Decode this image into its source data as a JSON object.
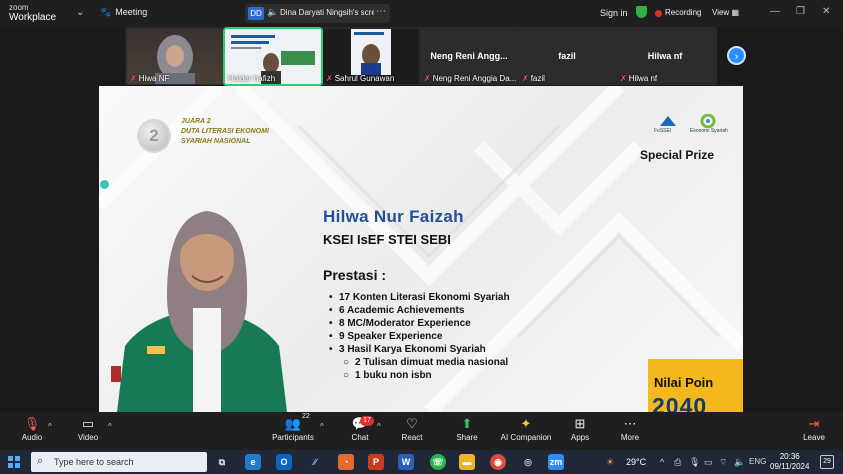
{
  "app": {
    "logo_line1": "zoom",
    "logo_line2": "Workplace",
    "meeting_label": "Meeting"
  },
  "share": {
    "badge": "DD",
    "text": "Dina Daryati Ningsih's screen",
    "more": "⋯"
  },
  "top_right": {
    "signin": "Sign in",
    "recording": "Recording",
    "view": "View"
  },
  "participants": [
    {
      "display_name": "Hiwa NF",
      "big_name": ""
    },
    {
      "display_name": "Haidar hafizh",
      "big_name": ""
    },
    {
      "display_name": "Sahrul Gunawan",
      "big_name": ""
    },
    {
      "display_name": "Neng Reni Anggia Da...",
      "big_name": "Neng Reni Angg..."
    },
    {
      "display_name": "fazil",
      "big_name": "fazil"
    },
    {
      "display_name": "Hilwa nf",
      "big_name": "Hilwa nf"
    }
  ],
  "slide": {
    "medal_number": "2",
    "award_line1": "JUARA 2",
    "award_line2": "DUTA LITERASI EKONOMI",
    "award_line3": "SYARIAH NASIONAL",
    "logo1_caption": "FoSSEI",
    "logo2_caption": "Ekonomi Syariah",
    "special": "Special Prize",
    "name": "Hilwa Nur Faizah",
    "org": "KSEI IsEF STEI SEBI",
    "prestasi_title": "Prestasi :",
    "achievements": [
      "17 Konten Literasi Ekonomi Syariah",
      "6 Academic Achievements",
      "8 MC/Moderator Experience",
      "9 Speaker Experience",
      "3 Hasil Karya Ekonomi Syariah"
    ],
    "sub_items": [
      "2 Tulisan dimuat media nasional",
      "1 buku non isbn"
    ],
    "nilai_label": "Nilai Poin",
    "nilai_value": "2040"
  },
  "controls": {
    "audio": "Audio",
    "video": "Video",
    "participants": "Participants",
    "participants_count": "22",
    "chat": "Chat",
    "chat_badge": "17",
    "react": "React",
    "share": "Share",
    "ai": "AI Companion",
    "apps": "Apps",
    "more": "More",
    "leave": "Leave"
  },
  "taskbar": {
    "search_placeholder": "Type here to search",
    "temperature": "29°C",
    "language": "ENG",
    "time": "20:36",
    "date": "09/11/2024",
    "notifications": "29"
  }
}
